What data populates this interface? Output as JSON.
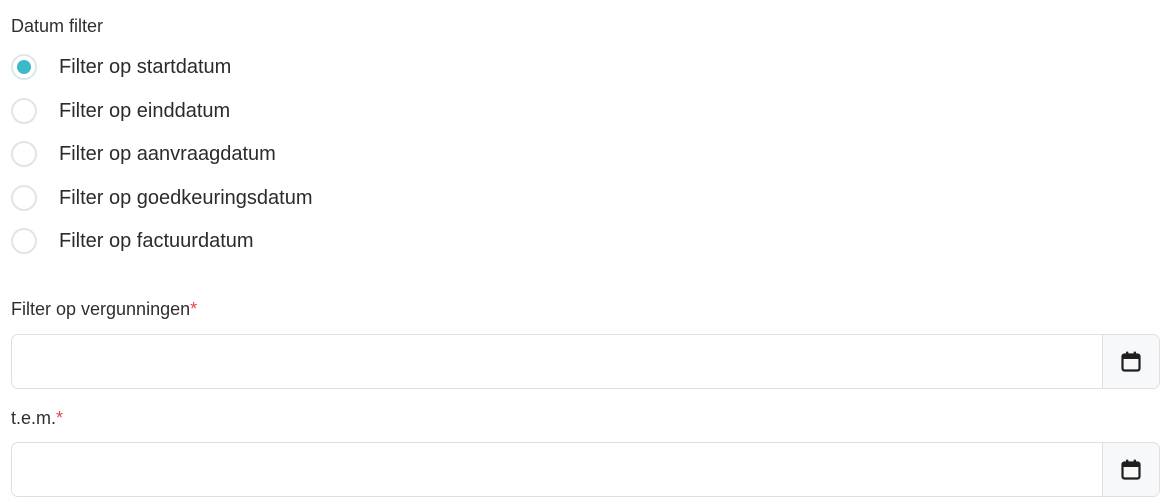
{
  "date_filter": {
    "label": "Datum filter",
    "selected_index": 0,
    "options": [
      {
        "label": "Filter op startdatum"
      },
      {
        "label": "Filter op einddatum"
      },
      {
        "label": "Filter op aanvraagdatum"
      },
      {
        "label": "Filter op goedkeuringsdatum"
      },
      {
        "label": "Filter op factuurdatum"
      }
    ]
  },
  "from_field": {
    "label": "Filter op vergunningen",
    "required_marker": "*",
    "value": "",
    "icon": "calendar-icon"
  },
  "to_field": {
    "label": "t.e.m.",
    "required_marker": "*",
    "value": "",
    "icon": "calendar-icon"
  },
  "colors": {
    "accent": "#3bb9c7",
    "required": "#e0454f",
    "border": "#dcdfe3"
  }
}
